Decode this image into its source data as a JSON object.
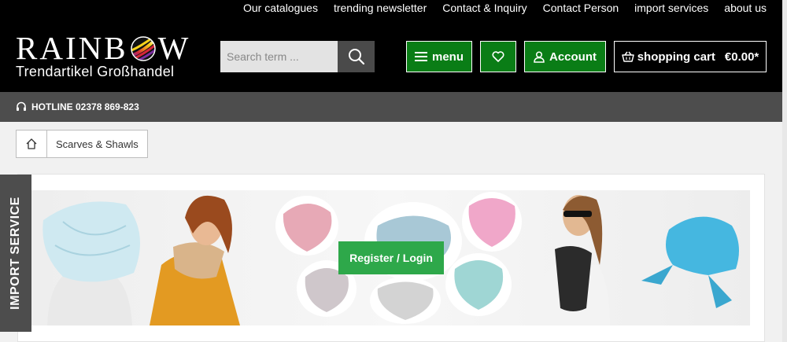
{
  "top_links": [
    "Our catalogues",
    "trending newsletter",
    "Contact & Inquiry",
    "Contact Person",
    "import services",
    "about us"
  ],
  "logo": {
    "word_left": "RAINB",
    "word_right": "W",
    "subtitle": "Trendartikel Großhandel"
  },
  "search": {
    "placeholder": "Search term ..."
  },
  "header_buttons": {
    "menu": "menu",
    "account": "Account",
    "cart_label": "shopping cart",
    "cart_total": "€0.00*"
  },
  "hotline": "HOTLINE 02378 869-823",
  "breadcrumb": {
    "current": "Scarves & Shawls"
  },
  "import_service": "IMPORT SERVICE",
  "banner": {
    "cta": "Register / Login"
  },
  "colors": {
    "header": "#000000",
    "accent_green": "#0a7d16",
    "cta_green": "#2ea84a",
    "hotline_bar": "#4d4d4d"
  },
  "icons": [
    "hamburger-icon",
    "heart-icon",
    "user-icon",
    "basket-icon",
    "headset-icon",
    "home-icon",
    "search-icon"
  ]
}
